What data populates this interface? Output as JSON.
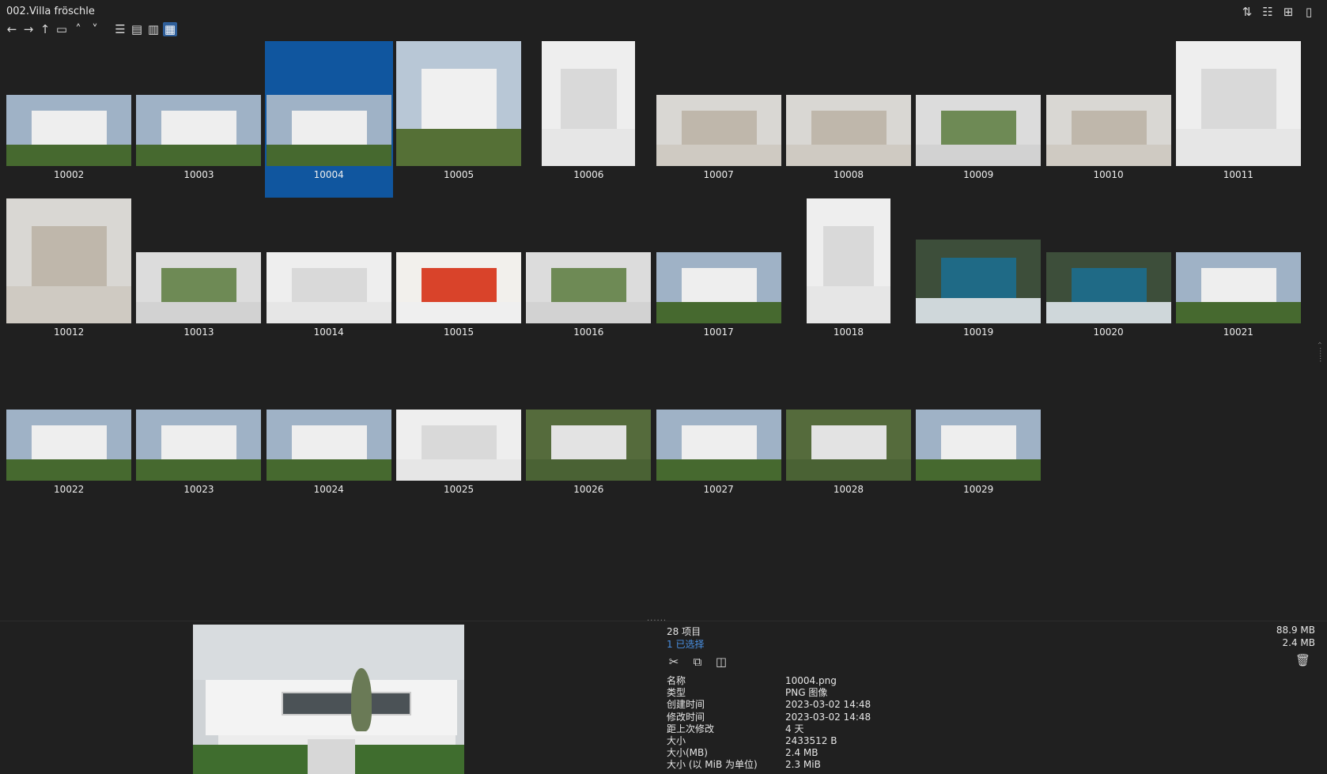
{
  "window": {
    "title": "002.Villa fröschle"
  },
  "toolbar": {
    "icons": [
      "arrow-left",
      "arrow-right",
      "arrow-up",
      "folder",
      "chevron-up",
      "chevron-down",
      "list-view",
      "details-view",
      "content-view",
      "thumbnail-view"
    ],
    "active": "thumbnail-view"
  },
  "top_right_icons": [
    "sort-icon",
    "group-icon",
    "new-tab-icon",
    "clipboard-icon"
  ],
  "thumbnails": [
    {
      "name": "10002",
      "palette": "exterior"
    },
    {
      "name": "10003",
      "palette": "exterior"
    },
    {
      "name": "10004",
      "palette": "exterior",
      "selected": true
    },
    {
      "name": "10005",
      "palette": "exterior-tall"
    },
    {
      "name": "10006",
      "palette": "interior-white"
    },
    {
      "name": "10007",
      "palette": "interior"
    },
    {
      "name": "10008",
      "palette": "interior"
    },
    {
      "name": "10009",
      "palette": "interior-green"
    },
    {
      "name": "10010",
      "palette": "interior"
    },
    {
      "name": "10011",
      "palette": "interior-white"
    },
    {
      "name": "10012",
      "palette": "interior"
    },
    {
      "name": "10013",
      "palette": "interior-green"
    },
    {
      "name": "10014",
      "palette": "interior-white"
    },
    {
      "name": "10015",
      "palette": "interior-red"
    },
    {
      "name": "10016",
      "palette": "interior-green"
    },
    {
      "name": "10017",
      "palette": "exterior"
    },
    {
      "name": "10018",
      "palette": "interior-white"
    },
    {
      "name": "10019",
      "palette": "pool"
    },
    {
      "name": "10020",
      "palette": "pool"
    },
    {
      "name": "10021",
      "palette": "exterior"
    },
    {
      "name": "10022",
      "palette": "exterior"
    },
    {
      "name": "10023",
      "palette": "exterior"
    },
    {
      "name": "10024",
      "palette": "exterior"
    },
    {
      "name": "10025",
      "palette": "interior-white"
    },
    {
      "name": "10026",
      "palette": "aerial"
    },
    {
      "name": "10027",
      "palette": "exterior"
    },
    {
      "name": "10028",
      "palette": "aerial"
    },
    {
      "name": "10029",
      "palette": "exterior"
    }
  ],
  "details": {
    "item_count": "28 项目",
    "selected_count": "1 已选择",
    "total_size": "88.9 MB",
    "selected_size": "2.4 MB",
    "action_icons": [
      "cut-icon",
      "copy-icon",
      "copy-path-icon"
    ],
    "properties": [
      {
        "key": "名称",
        "value": "10004.png"
      },
      {
        "key": "类型",
        "value": "PNG 图像"
      },
      {
        "key": "创建时间",
        "value": "2023-03-02  14:48"
      },
      {
        "key": "修改时间",
        "value": "2023-03-02  14:48"
      },
      {
        "key": "距上次修改",
        "value": "4 天"
      },
      {
        "key": "大小",
        "value": "2433512 B"
      },
      {
        "key": "大小(MB)",
        "value": "2.4 MB"
      },
      {
        "key": "大小 (以 MiB 为单位)",
        "value": "2.3 MiB"
      }
    ]
  },
  "colors": {
    "background": "#202020",
    "selection": "#10569f",
    "accent_text": "#4a90e2"
  }
}
